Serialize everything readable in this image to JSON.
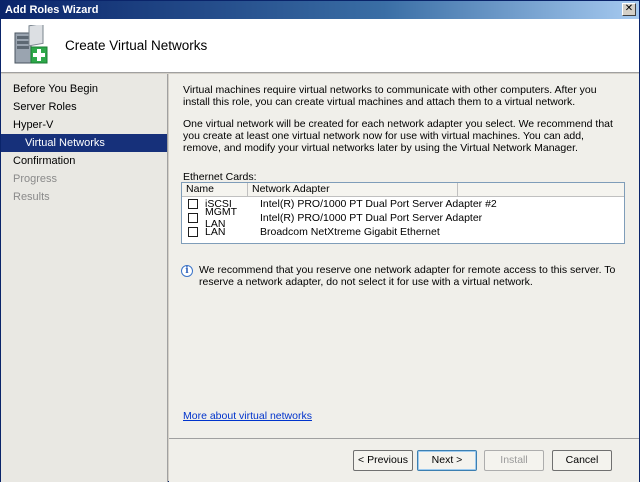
{
  "window": {
    "title": "Add Roles Wizard",
    "close_glyph": "✕"
  },
  "header": {
    "title": "Create Virtual Networks",
    "icon": "server-add-icon"
  },
  "sidebar": {
    "items": [
      {
        "label": "Before You Begin",
        "state": "normal"
      },
      {
        "label": "Server Roles",
        "state": "normal"
      },
      {
        "label": "Hyper-V",
        "state": "normal"
      },
      {
        "label": "Virtual Networks",
        "state": "active"
      },
      {
        "label": "Confirmation",
        "state": "normal"
      },
      {
        "label": "Progress",
        "state": "disabled"
      },
      {
        "label": "Results",
        "state": "disabled"
      }
    ]
  },
  "content": {
    "para1": "Virtual machines require virtual networks to communicate with other computers. After you install this role, you can create virtual machines and attach them to a virtual network.",
    "para2": "One virtual network will be created for each network adapter you select. We recommend that you create at least one virtual network now for use with virtual machines. You can add, remove, and modify your virtual networks later by using the Virtual Network Manager.",
    "ethernet_label": "Ethernet Cards:",
    "table": {
      "headers": [
        "Name",
        "Network Adapter"
      ],
      "rows": [
        {
          "name": "iSCSI",
          "adapter": "Intel(R) PRO/1000 PT Dual Port Server Adapter #2",
          "checked": false
        },
        {
          "name": "MGMT LAN",
          "adapter": "Intel(R) PRO/1000 PT Dual Port Server Adapter",
          "checked": false
        },
        {
          "name": "LAN",
          "adapter": "Broadcom NetXtreme Gigabit Ethernet",
          "checked": false
        }
      ]
    },
    "info_text": "We recommend that you reserve one network adapter for remote access to this server. To reserve a network adapter, do not select it for use with a virtual network.",
    "info_glyph": "i",
    "more_link": "More about virtual networks"
  },
  "footer": {
    "prev_label": "< Previous",
    "next_label": "Next >",
    "install_label": "Install",
    "cancel_label": "Cancel"
  },
  "colors": {
    "accent": "#16307a",
    "link": "#0033cc"
  }
}
